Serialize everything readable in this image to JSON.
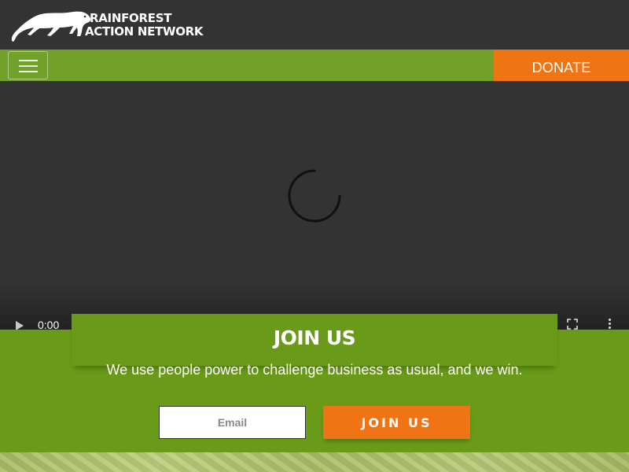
{
  "header": {
    "logo_line1": "RAINFOREST",
    "logo_line2": "ACTION NETWORK",
    "logo_icon": "panther-icon"
  },
  "nav": {
    "menu_icon": "hamburger-menu-icon",
    "donate_label": "DONATE"
  },
  "video": {
    "time": "0:00",
    "icons": [
      "loading-spinner-icon",
      "play-icon",
      "fullscreen-icon",
      "more-vertical-icon"
    ]
  },
  "join": {
    "title": "JOIN US",
    "description": "We use people power to challenge business as usual, and we win.",
    "email_placeholder": "Email",
    "button_label": "JOIN US"
  },
  "colors": {
    "header_bg": "#333333",
    "nav_green": "#72a22a",
    "band_green": "#6a9b18",
    "accent_orange": "#f07314",
    "text": "#ffffff"
  }
}
